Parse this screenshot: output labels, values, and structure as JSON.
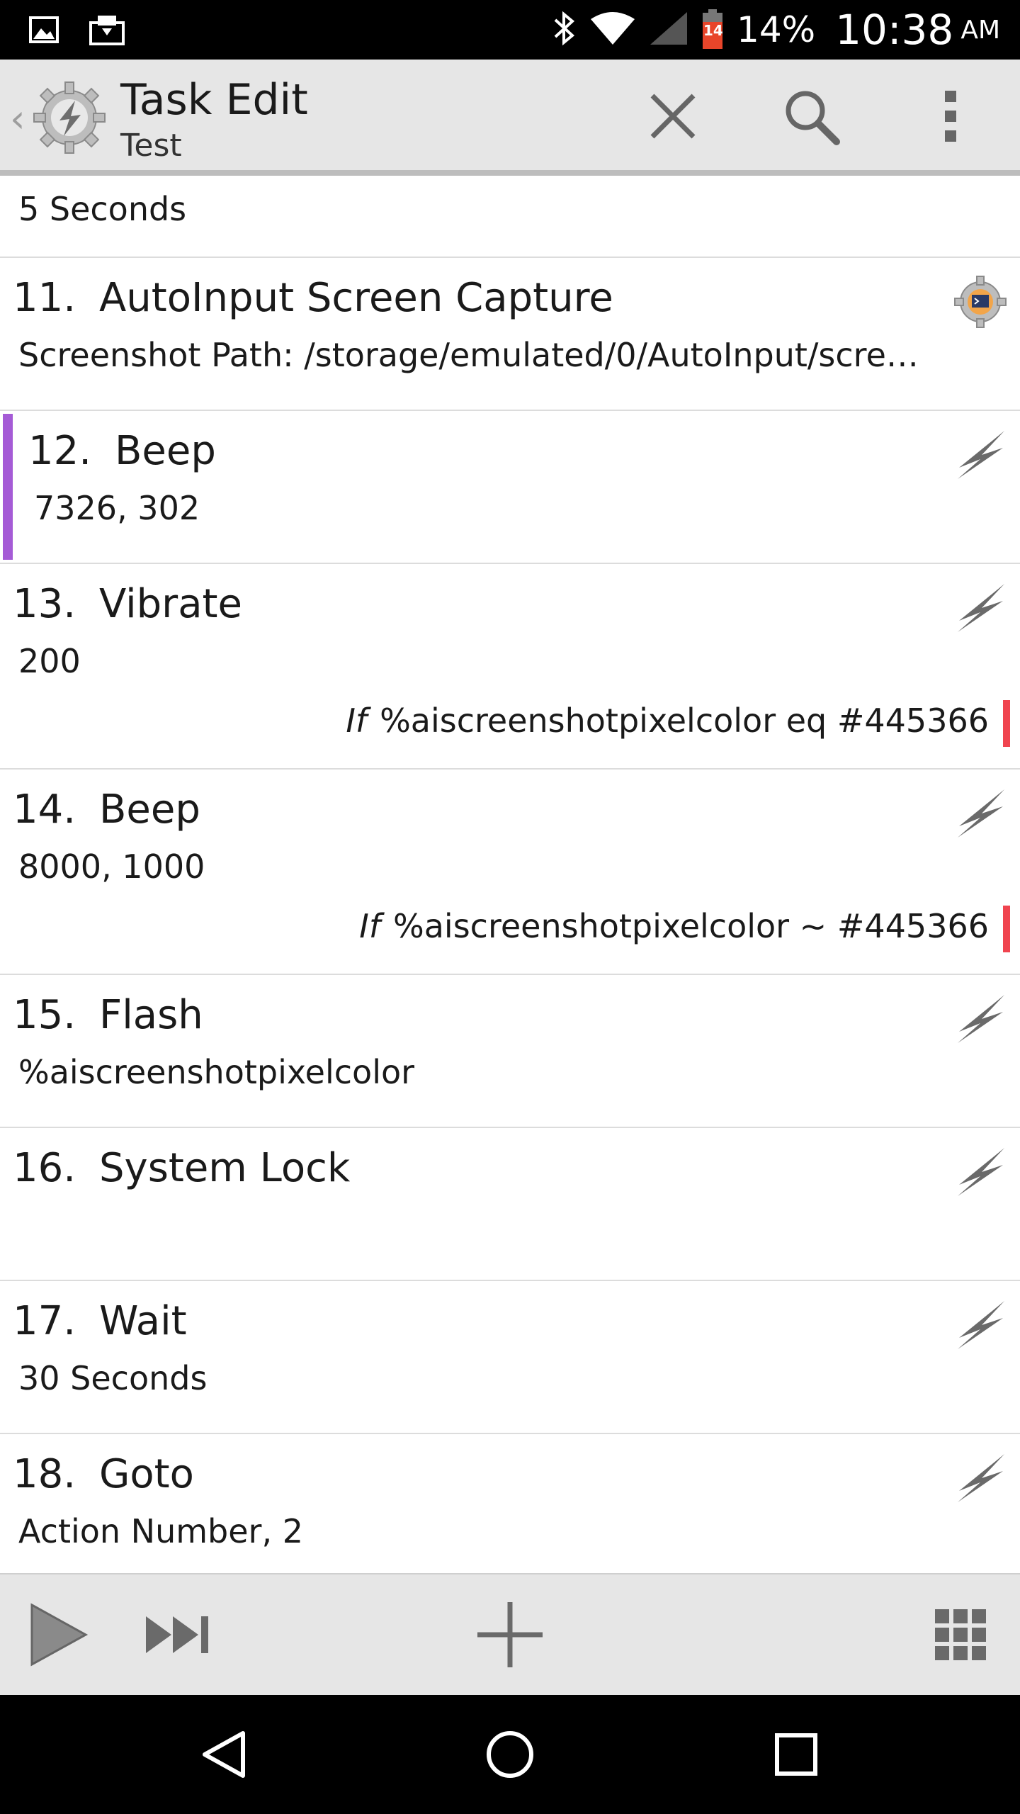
{
  "status_bar": {
    "battery_icon_text": "14",
    "battery_percent": "14%",
    "time": "10:38",
    "ampm": "AM"
  },
  "action_bar": {
    "back_glyph": "‹",
    "title": "Task Edit",
    "subtitle": "Test"
  },
  "list": {
    "top_partial_sub": "5 Seconds",
    "items": [
      {
        "num": "11.",
        "name": "AutoInput Screen Capture",
        "sub": "Screenshot Path: /storage/emulated/0/AutoInput/scre…",
        "icon": "autoinput-plugin-icon"
      },
      {
        "num": "12.",
        "name": "Beep",
        "sub": "7326,  302",
        "icon": "lightning-icon",
        "selected": true
      },
      {
        "num": "13.",
        "name": "Vibrate",
        "sub": "200",
        "cond_if": "If",
        "cond": "%aiscreenshotpixelcolor eq #445366",
        "icon": "lightning-icon"
      },
      {
        "num": "14.",
        "name": "Beep",
        "sub": "8000,  1000",
        "cond_if": "If",
        "cond": "%aiscreenshotpixelcolor ~ #445366",
        "icon": "lightning-icon"
      },
      {
        "num": "15.",
        "name": "Flash",
        "sub": "%aiscreenshotpixelcolor",
        "icon": "lightning-icon"
      },
      {
        "num": "16.",
        "name": "System Lock",
        "sub": "",
        "icon": "lightning-icon"
      },
      {
        "num": "17.",
        "name": "Wait",
        "sub": "30 Seconds",
        "icon": "lightning-icon"
      },
      {
        "num": "18.",
        "name": "Goto",
        "sub": "Action Number,  2",
        "icon": "lightning-icon"
      }
    ]
  },
  "colors": {
    "selection_bar": "#a55bd6",
    "condition_bar": "#f0444f",
    "toolbar_bg": "#e6e6e6"
  }
}
